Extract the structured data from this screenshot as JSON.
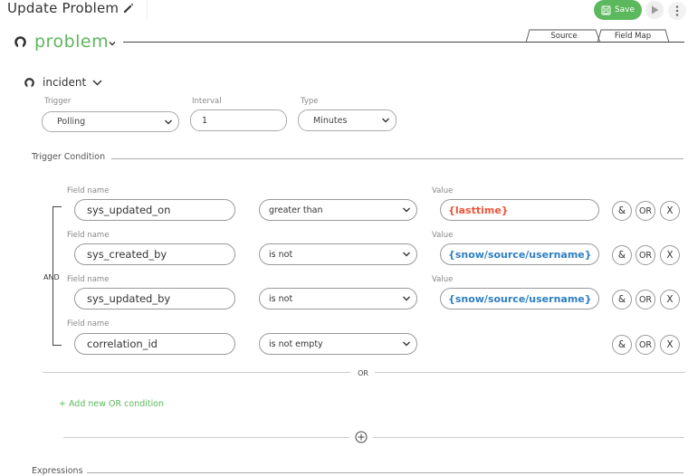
{
  "header": {
    "title": "Update Problem",
    "save_label": "Save"
  },
  "main": {
    "section_title": "problem",
    "tabs": [
      {
        "label": "Source",
        "active": true
      },
      {
        "label": "Field Map",
        "active": false
      }
    ]
  },
  "incident": {
    "label": "incident",
    "trigger": {
      "label": "Trigger",
      "value": "Polling"
    },
    "interval": {
      "label": "Interval",
      "value": "1"
    },
    "type": {
      "label": "Type",
      "value": "Minutes"
    }
  },
  "trigger_condition": {
    "label": "Trigger Condition",
    "group_operator": "AND",
    "or_separator": "OR",
    "add_or_label": "+ Add new OR condition",
    "rows": [
      {
        "field_label": "Field name",
        "field": "sys_updated_on",
        "operator": "greater than",
        "value_label": "Value",
        "value": "{lasttime}",
        "value_color": "#e8563a"
      },
      {
        "field_label": "Field name",
        "field": "sys_created_by",
        "operator": "is not",
        "value_label": "Value",
        "value": "{snow/source/username}",
        "value_color": "#2d7fc1"
      },
      {
        "field_label": "Field name",
        "field": "sys_updated_by",
        "operator": "is not",
        "value_label": "Value",
        "value": "{snow/source/username}",
        "value_color": "#2d7fc1"
      },
      {
        "field_label": "Field name",
        "field": "correlation_id",
        "operator": "is not empty"
      }
    ],
    "row_buttons": {
      "and": "&",
      "or": "OR",
      "remove": "X"
    }
  },
  "expressions": {
    "label": "Expressions"
  },
  "colors": {
    "accent_green": "#5cb85c",
    "token_orange": "#e8563a",
    "token_blue": "#2d7fc1"
  }
}
